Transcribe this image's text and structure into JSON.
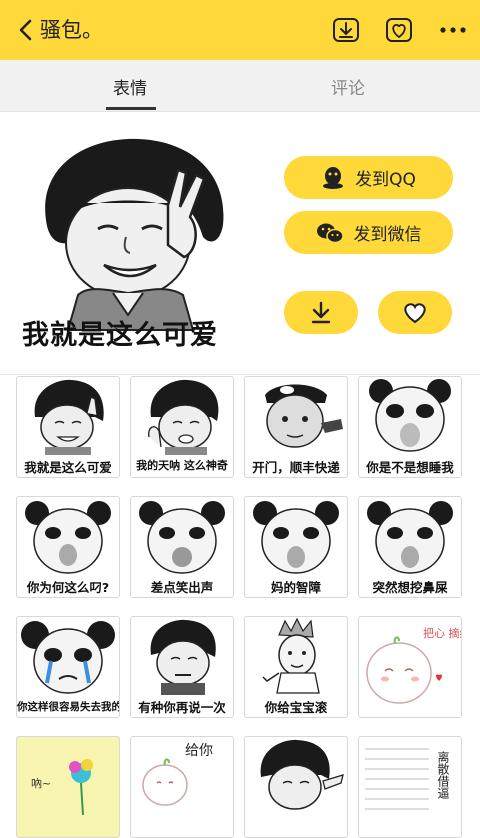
{
  "header": {
    "title": "骚包。",
    "icons": [
      "back-arrow-icon",
      "download-box-icon",
      "favorite-box-icon",
      "more-dots-icon"
    ]
  },
  "tabs": [
    {
      "label": "表情",
      "active": true
    },
    {
      "label": "评论",
      "active": false
    }
  ],
  "preview": {
    "caption": "我就是这么可爱",
    "send_qq": "发到QQ",
    "send_wechat": "发到微信"
  },
  "grid": [
    {
      "caption": "我就是这么可爱"
    },
    {
      "caption": "我的天呐 这么神奇"
    },
    {
      "caption": "开门，顺丰快递"
    },
    {
      "caption": "你是不是想睡我"
    },
    {
      "caption": "你为何这么叼?"
    },
    {
      "caption": "差点笑出声"
    },
    {
      "caption": "妈的智障"
    },
    {
      "caption": "突然想挖鼻屎"
    },
    {
      "caption": "你这样很容易失去我的"
    },
    {
      "caption": "有种你再说一次"
    },
    {
      "caption": "你给宝宝滚"
    },
    {
      "caption": "把心 摘给 你"
    },
    {
      "caption": "吶~"
    },
    {
      "caption": "给你"
    },
    {
      "caption": ""
    },
    {
      "caption": "离散借逼"
    }
  ],
  "colors": {
    "accent": "#ffd83a",
    "tab_bg": "#f1f1f1"
  }
}
